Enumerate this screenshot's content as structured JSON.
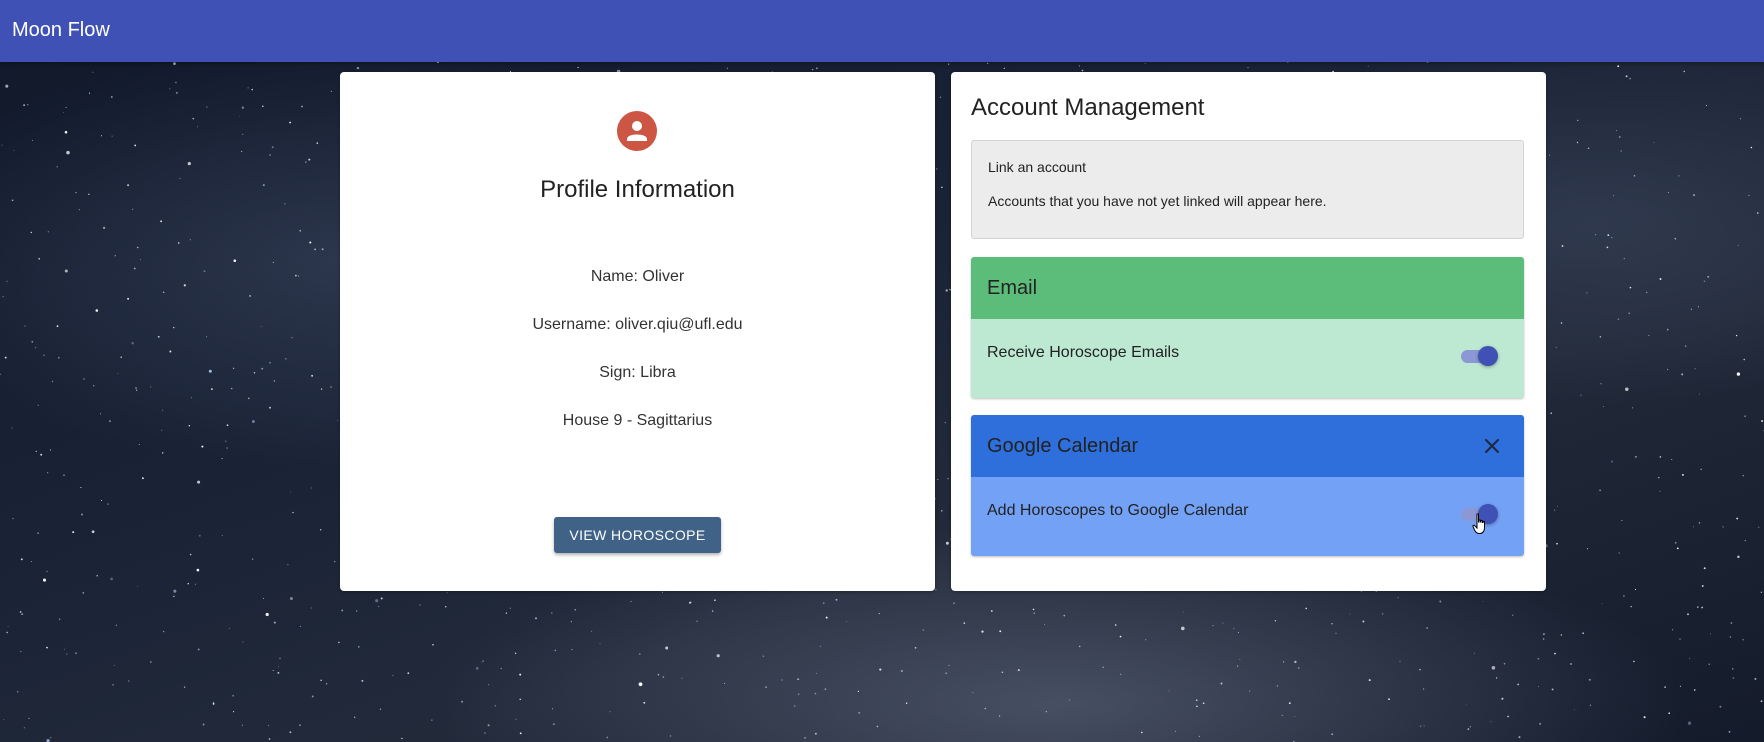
{
  "app": {
    "title": "Moon Flow"
  },
  "profile": {
    "avatar_icon": "person-icon",
    "title": "Profile Information",
    "name_line": "Name: Oliver",
    "username_line": "Username: oliver.qiu@ufl.edu",
    "sign_line": "Sign: Libra",
    "house_line": "House 9 - Sagittarius",
    "view_button": "VIEW HOROSCOPE"
  },
  "account": {
    "title": "Account Management",
    "link_panel": {
      "title": "Link an account",
      "description": "Accounts that you have not yet linked will appear here."
    },
    "services": {
      "email": {
        "name": "Email",
        "setting_label": "Receive Horoscope Emails",
        "enabled": true,
        "header_color": "#5cbd7b",
        "body_color": "#bde8d1"
      },
      "google_calendar": {
        "name": "Google Calendar",
        "close_icon": "close-icon",
        "setting_label": "Add Horoscopes to Google Calendar",
        "enabled": true,
        "header_color": "#2f6fdc",
        "body_color": "#73a1f6"
      }
    }
  },
  "colors": {
    "app_bar": "#3f51b5",
    "avatar": "#cc5643",
    "button": "#3f6286",
    "switch_on": "#3f51b5"
  }
}
